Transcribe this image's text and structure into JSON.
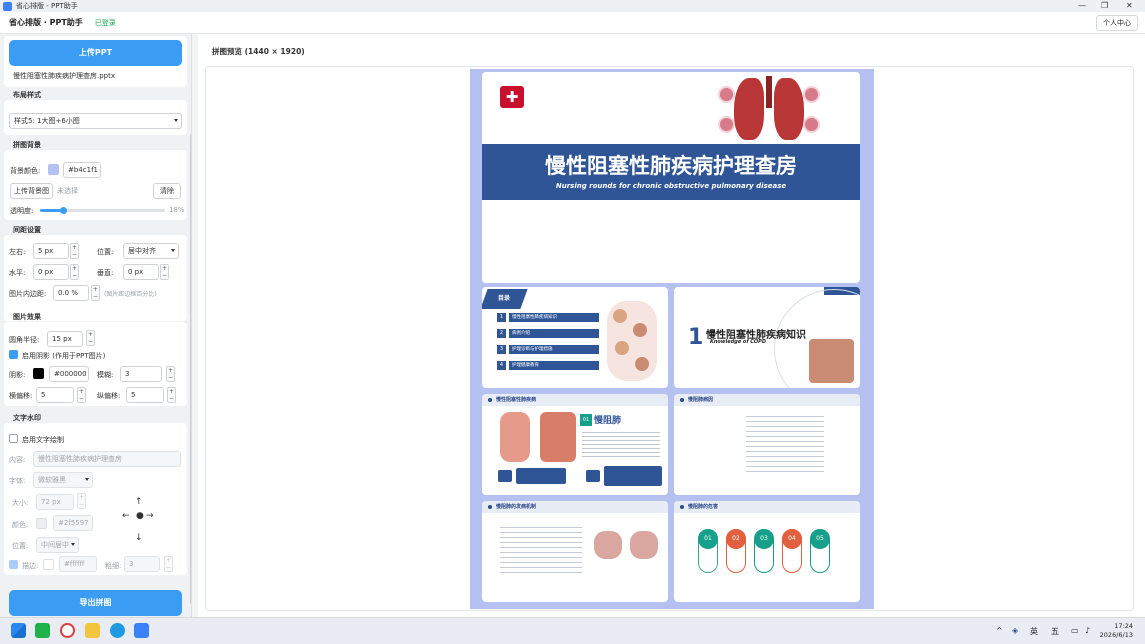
{
  "window": {
    "title": "省心排版 - PPT助手"
  },
  "header": {
    "title": "省心排版 · PPT助手",
    "status": "已登录",
    "user_center": "个人中心"
  },
  "sidebar": {
    "upload_button": "上传PPT",
    "file_name": "慢性阻塞性肺疾病护理查房.pptx",
    "layout": {
      "title": "布局样式",
      "selected": "样式5: 1大图+6小图"
    },
    "background": {
      "title": "拼图背景",
      "color_label": "背景颜色:",
      "color_value": "#b4c1f1",
      "upload_label": "上传背景图",
      "upload_status": "未选择",
      "clear": "清除",
      "opacity_label": "透明度:",
      "opacity_value": "18%",
      "opacity_fraction": 0.18
    },
    "spacing": {
      "title": "间距设置",
      "lr_label": "左右:",
      "lr_value": "5 px",
      "pos_label": "位置:",
      "pos_value": "居中对齐",
      "h_label": "水平:",
      "h_value": "0 px",
      "v_label": "垂直:",
      "v_value": "0 px",
      "pad_label": "图片内边距:",
      "pad_value": "0.0 %",
      "pad_hint": "(图片距边框百分比)"
    },
    "effect": {
      "title": "图片效果",
      "radius_label": "圆角半径:",
      "radius_value": "15 px",
      "shadow_toggle": "启用阴影 (作用于PPT图片)",
      "shadow_label": "阴影:",
      "shadow_color": "#000000",
      "blur_label": "模糊:",
      "blur_value": "3",
      "hoff_label": "横偏移:",
      "hoff_value": "5",
      "voff_label": "纵偏移:",
      "voff_value": "5"
    },
    "watermark": {
      "title": "文字水印",
      "toggle": "启用文字绘制",
      "content_label": "内容:",
      "content_value": "慢性阻塞性肺疾病护理查房",
      "font_label": "字体:",
      "font_value": "微软雅黑",
      "size_label": "大小:",
      "size_value": "72 px",
      "color_label": "颜色:",
      "color_value": "#2f5597",
      "pos_label": "位置:",
      "pos_value": "中间居中",
      "stroke_label": "描边:",
      "stroke_value": "#ffffff",
      "thick_label": "粗细:",
      "thick_value": "3"
    },
    "export_button": "导出拼图"
  },
  "preview": {
    "title": "拼图预览 (1440 × 1920)"
  },
  "slides": {
    "cover_title": "慢性阻塞性肺疾病护理查房",
    "cover_sub": "Nursing rounds for chronic obstructive pulmonary disease",
    "toc_tag": "目录",
    "toc": [
      "慢性阻塞性肺疾病知识",
      "病例介绍",
      "护理诊断与护理措施",
      "护理健康教育"
    ],
    "toc_nums": [
      "1",
      "2",
      "3",
      "4"
    ],
    "s3_num": "1",
    "s3_title": "慢性阻塞性肺疾病知识",
    "s3_sub": "Knowledge of COPD",
    "s4_title": "慢性阻塞性肺疾病",
    "s4_big": "慢阻肺",
    "s4_num": "01",
    "s5_title": "慢阻肺病因",
    "s6_title": "慢阻肺的发病机制",
    "s7_title": "慢阻肺的危害",
    "s7_nums": [
      "01",
      "02",
      "03",
      "04",
      "05"
    ]
  },
  "taskbar": {
    "time": "17:24",
    "date": "2026/6/13",
    "ime1": "英",
    "ime2": "五"
  },
  "colors": {
    "canvas_bg": "#b4c1f1",
    "accent": "#3b9cf4",
    "slide_blue": "#2c4a8a"
  }
}
